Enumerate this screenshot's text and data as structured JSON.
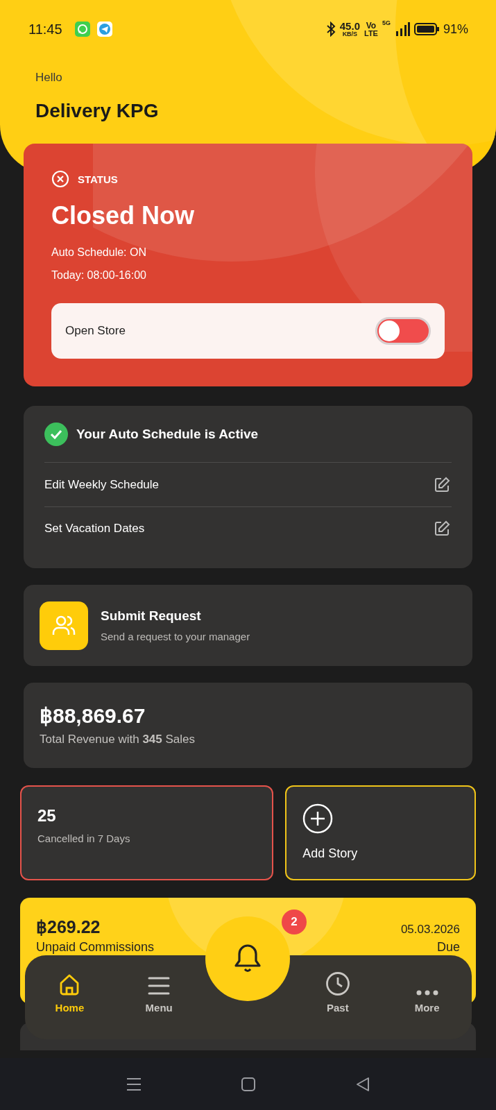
{
  "status_bar": {
    "time": "11:45",
    "speed": "45.0",
    "speed_unit": "KB/S",
    "volte_top": "Vo",
    "volte_bottom": "LTE",
    "network": "5G",
    "battery": "91%"
  },
  "greeting": {
    "hello": "Hello",
    "name": "Delivery KPG"
  },
  "store_status": {
    "label": "STATUS",
    "title": "Closed Now",
    "lines": [
      "Auto Schedule: ON",
      "Today: 08:00-16:00"
    ],
    "toggle": {
      "label": "Open Store",
      "on": false
    }
  },
  "schedule": {
    "title": "Your Auto Schedule is Active",
    "items": [
      {
        "label": "Edit Weekly Schedule"
      },
      {
        "label": "Set Vacation Dates"
      }
    ]
  },
  "request": {
    "title": "Submit Request",
    "subtitle": "Send a request to your manager"
  },
  "revenue": {
    "amount": "฿88,869.67",
    "caption": "Total Revenue with **345** Sales"
  },
  "stats": [
    {
      "kind": "count",
      "value": "25",
      "label": "Cancelled in 7 Days"
    },
    {
      "kind": "action",
      "label": "Add Story"
    }
  ],
  "commission": {
    "amount": "฿269.22",
    "date": "05.03.2026",
    "label": "Unpaid Commissions",
    "due": "Due"
  },
  "notifications": {
    "badge": "2"
  },
  "tabs": [
    {
      "kind": "home",
      "label": "Home",
      "selected": true
    },
    {
      "kind": "menu",
      "label": "Menu",
      "selected": false
    },
    {
      "kind": "past",
      "label": "Past",
      "selected": false
    },
    {
      "kind": "more",
      "label": "More",
      "selected": false
    }
  ]
}
